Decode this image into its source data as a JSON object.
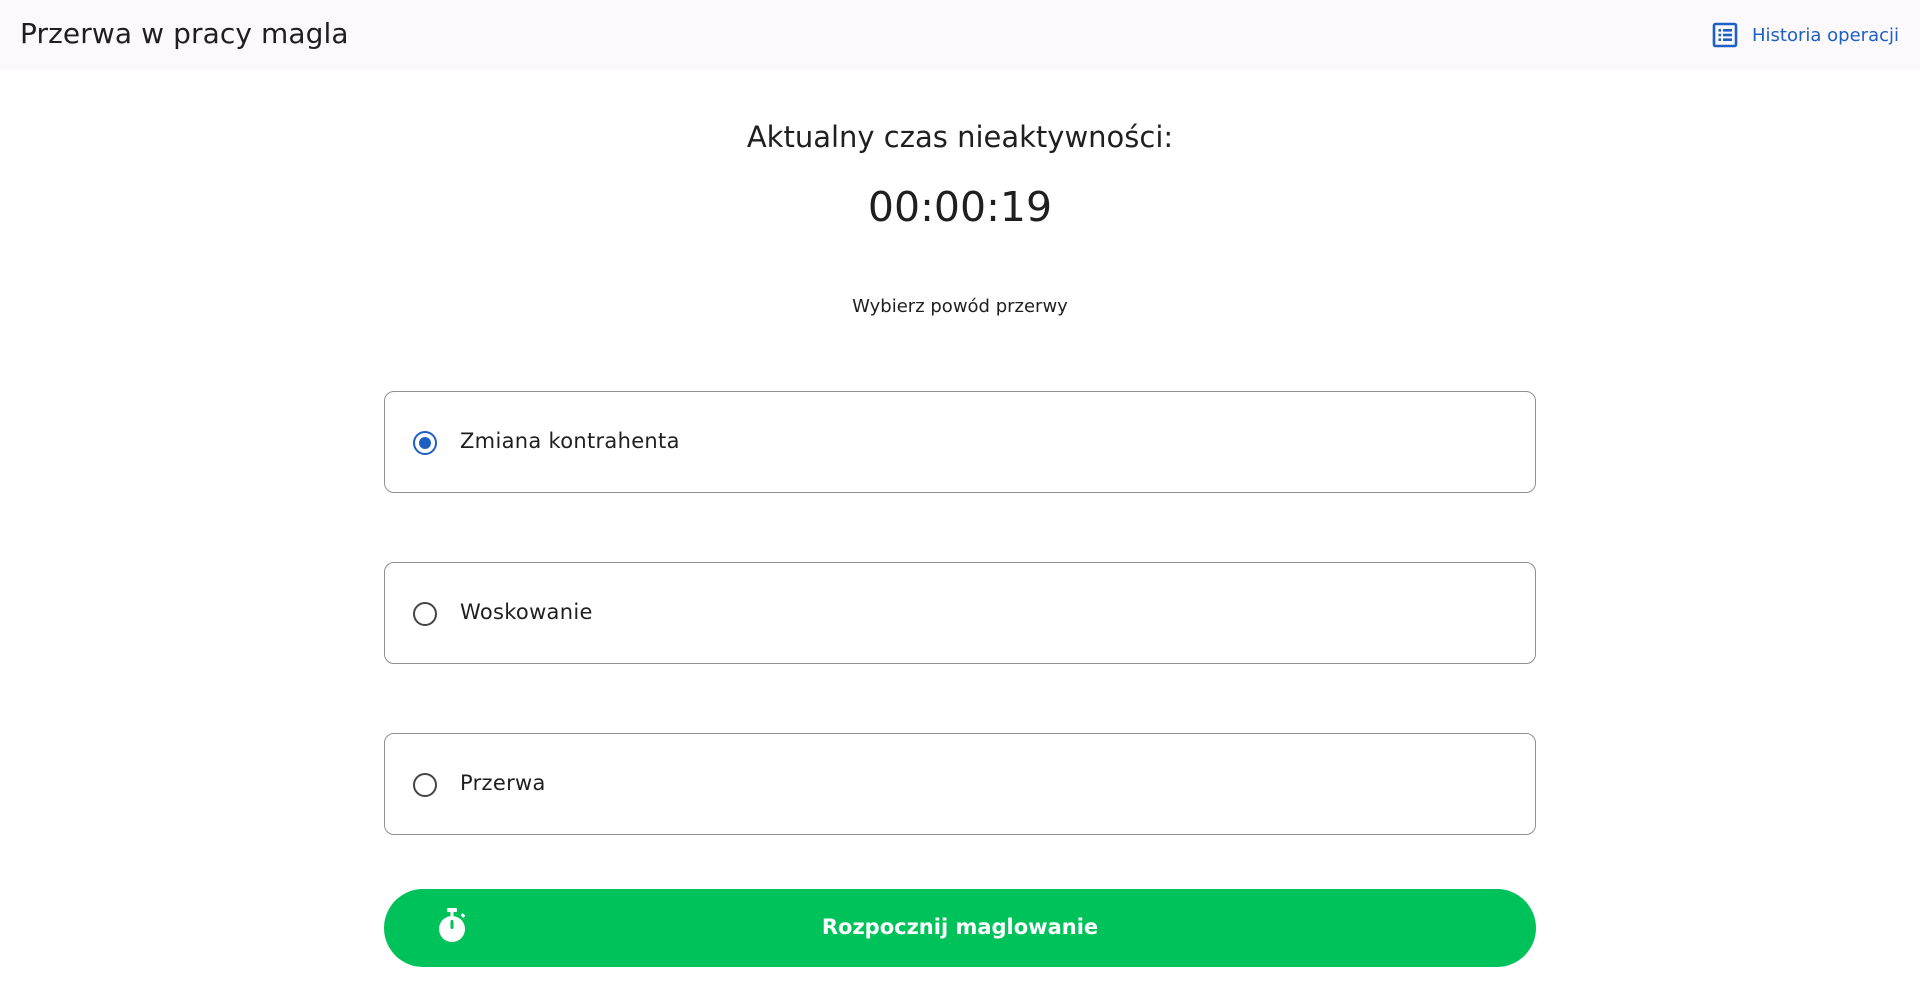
{
  "header": {
    "title": "Przerwa w pracy magla",
    "history_label": "Historia operacji",
    "history_icon": "list-icon"
  },
  "main": {
    "inactivity_title": "Aktualny czas nieaktywności:",
    "timer_value": "00:00:19",
    "reason_prompt": "Wybierz powód przerwy",
    "options": [
      {
        "label": "Zmiana kontrahenta",
        "selected": true
      },
      {
        "label": "Woskowanie",
        "selected": false
      },
      {
        "label": "Przerwa",
        "selected": false
      }
    ],
    "start_button": {
      "label": "Rozpocznij maglowanie",
      "icon": "stopwatch-icon"
    }
  },
  "colors": {
    "accent_blue": "#1d5fc2",
    "button_green": "#00c25a",
    "header_bg": "#fbf9fc"
  }
}
